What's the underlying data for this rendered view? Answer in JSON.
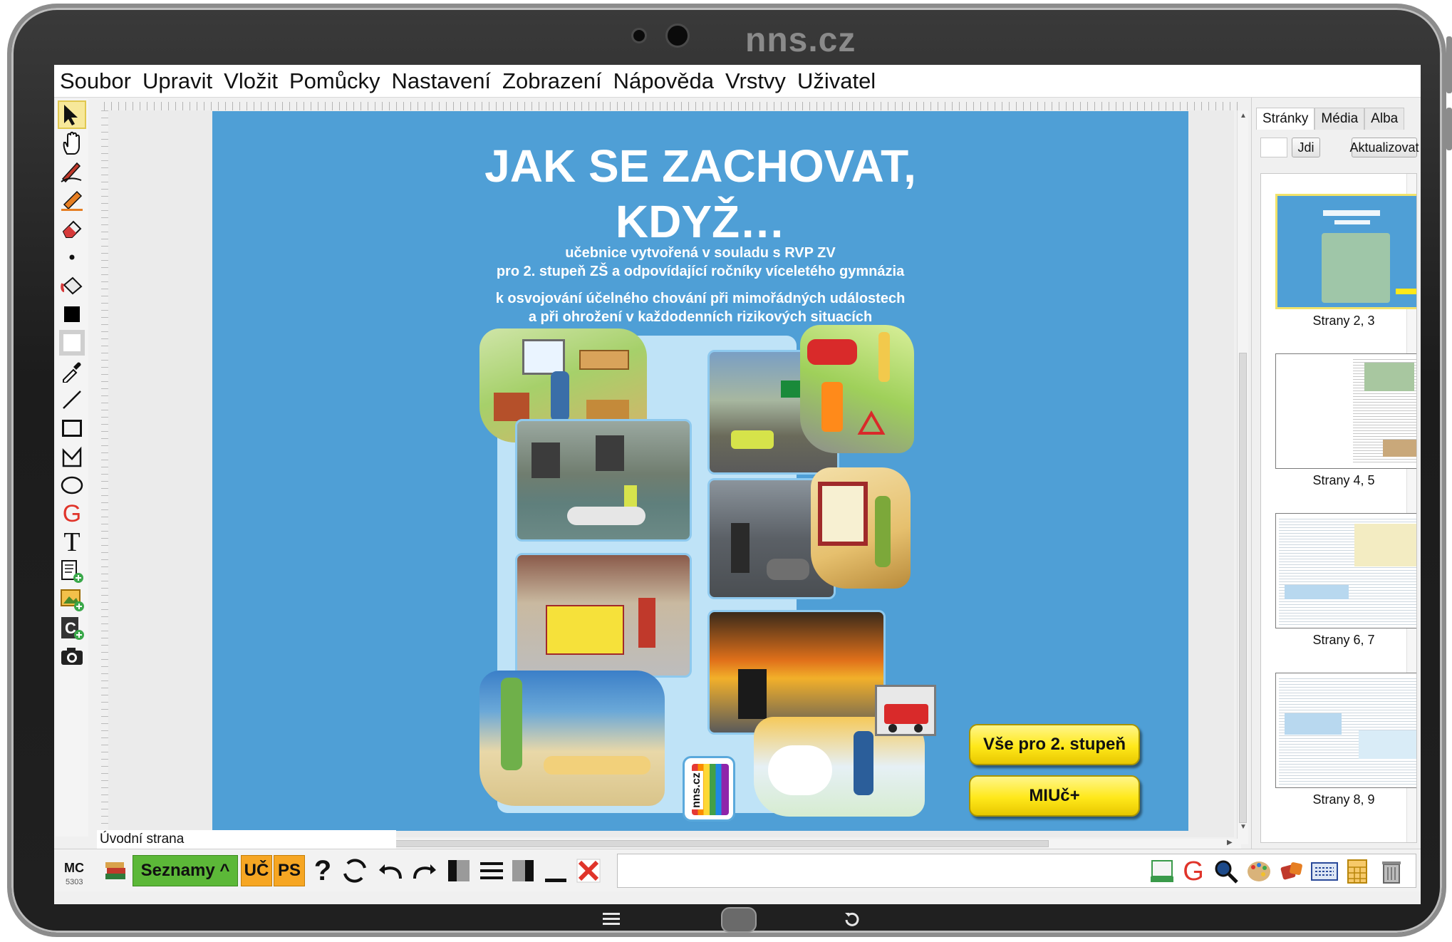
{
  "brand": "nns.cz",
  "menu": [
    "Soubor",
    "Upravit",
    "Vložit",
    "Pomůcky",
    "Nastavení",
    "Zobrazení",
    "Nápověda",
    "Vrstvy",
    "Uživatel"
  ],
  "cover": {
    "title_line1": "JAK SE ZACHOVAT,",
    "title_line2": "KDYŽ…",
    "sub1_line1": "učebnice vytvořená v souladu s RVP ZV",
    "sub1_line2": "pro 2. stupeň ZŠ a odpovídající ročníky víceletého gymnázia",
    "sub2_line1": "k osvojování účelného chování při mimořádných událostech",
    "sub2_line2": "a při ohrožení v každodenních rizikových situacích",
    "logo_text": "nns.cz",
    "button1": "Vše pro 2. stupeň",
    "button2": "MIUč+"
  },
  "page_label": "Úvodní strana",
  "panel": {
    "tabs": [
      "Stránky",
      "Média",
      "Alba"
    ],
    "jdi": "Jdi",
    "aktualizovat": "Aktualizovat",
    "thumbs": [
      "Strany 2, 3",
      "Strany 4, 5",
      "Strany 6, 7",
      "Strany 8, 9"
    ]
  },
  "bottombar": {
    "mc": "MC",
    "mc_num": "5303",
    "seznamy": "Seznamy ^",
    "uc": "UČ",
    "ps": "PS",
    "help": "?",
    "google": "G"
  },
  "colors": {
    "page_blue": "#4f9fd6",
    "button_yellow": "#ffe81a",
    "seznamy_green": "#5cb838",
    "badge_orange": "#f6a623",
    "google_red": "#e0342a"
  },
  "icons": [
    "arrow-pointer-icon",
    "hand-icon",
    "pen-icon",
    "highlighter-icon",
    "eraser-icon",
    "dot-icon",
    "fill-bucket-icon",
    "filled-square-icon",
    "outlined-square-icon",
    "eyedropper-icon",
    "line-icon",
    "rectangle-icon",
    "polygon-icon",
    "ellipse-icon",
    "google-icon",
    "text-icon",
    "note-add-icon",
    "image-add-icon",
    "card-add-icon",
    "camera-icon"
  ]
}
